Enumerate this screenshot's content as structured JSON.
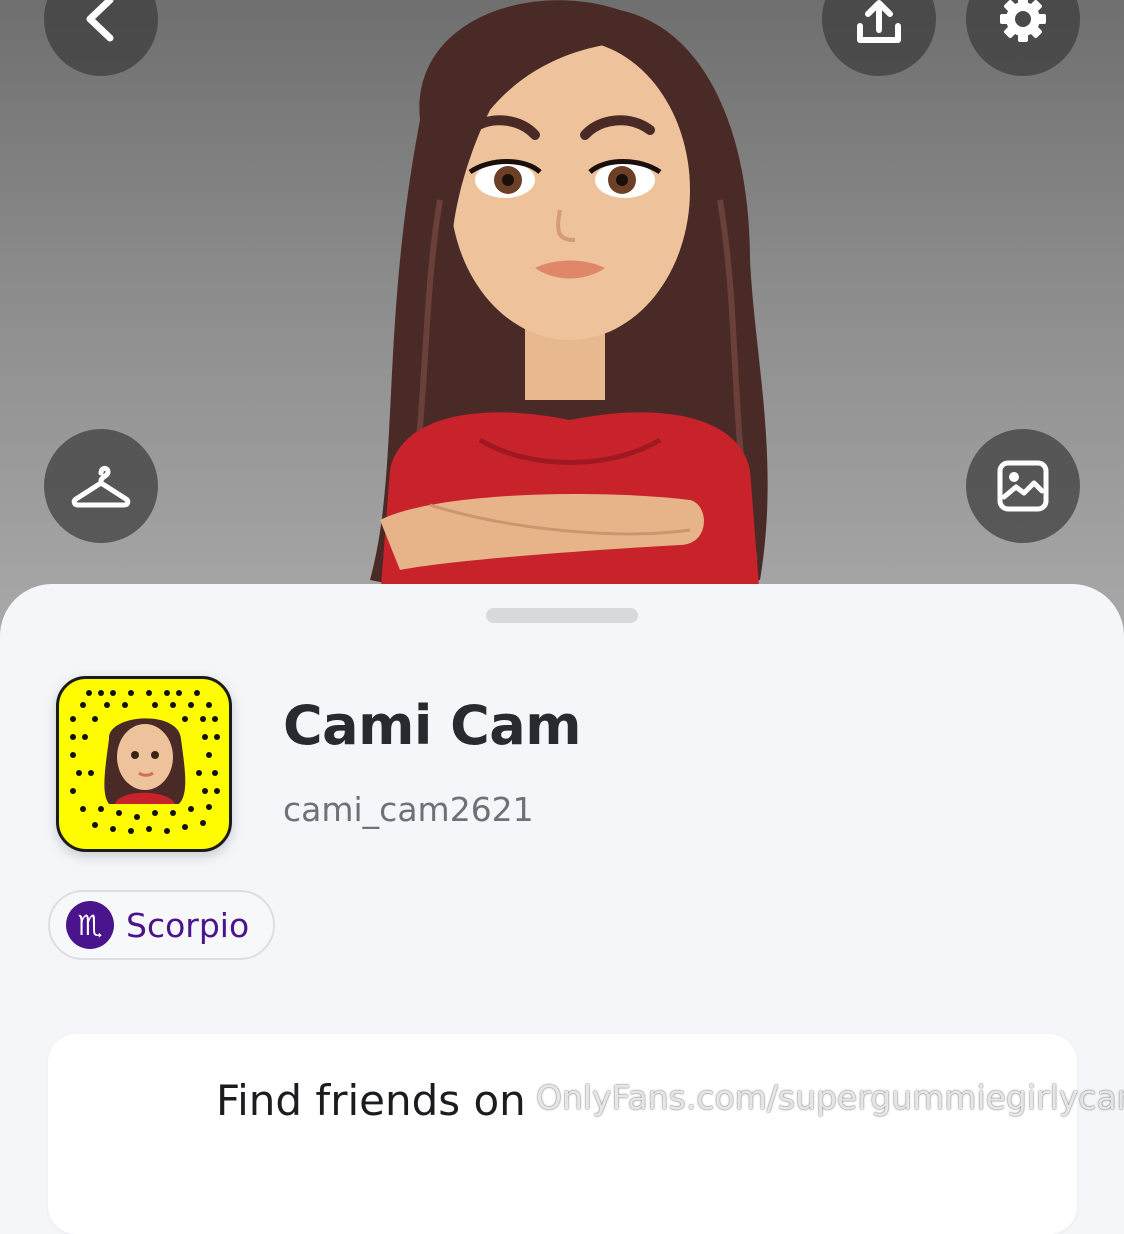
{
  "header": {
    "back_icon": "chevron-left-icon",
    "share_icon": "share-upload-icon",
    "settings_icon": "gear-icon",
    "outfit_icon": "hanger-icon",
    "background_icon": "image-icon"
  },
  "profile": {
    "display_name": "Cami Cam",
    "username": "cami_cam2621",
    "zodiac": {
      "symbol": "♏",
      "label": "Scorpio"
    }
  },
  "find_friends_card": {
    "title": "Find friends on"
  },
  "watermark": "OnlyFans.com/supergummiegirlycami",
  "colors": {
    "snapcode_yellow": "#fffc00",
    "zodiac_purple": "#4a148c",
    "sheet_bg": "#f5f6f9",
    "name_text": "#272a2f"
  }
}
